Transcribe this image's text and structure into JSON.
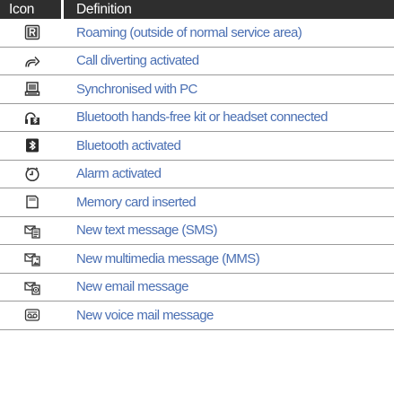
{
  "header": {
    "icon_col": "Icon",
    "definition_col": "Definition"
  },
  "colors": {
    "header_bg": "#2e2e2e",
    "header_text": "#ffffff",
    "definition_text": "#4a6fb3",
    "row_divider": "#9a9a9a",
    "icon_stroke": "#333333"
  },
  "rows": [
    {
      "icon": "roaming-icon",
      "definition": "Roaming (outside of normal service area)"
    },
    {
      "icon": "call-divert-icon",
      "definition": "Call diverting activated"
    },
    {
      "icon": "pc-sync-icon",
      "definition": "Synchronised with PC"
    },
    {
      "icon": "bt-headset-icon",
      "definition": "Bluetooth hands-free kit or headset connected"
    },
    {
      "icon": "bluetooth-icon",
      "definition": "Bluetooth activated"
    },
    {
      "icon": "alarm-icon",
      "definition": "Alarm activated"
    },
    {
      "icon": "memory-card-icon",
      "definition": "Memory card inserted"
    },
    {
      "icon": "sms-icon",
      "definition": "New text message (SMS)"
    },
    {
      "icon": "mms-icon",
      "definition": "New multimedia message (MMS)"
    },
    {
      "icon": "email-icon",
      "definition": "New email message"
    },
    {
      "icon": "voicemail-icon",
      "definition": "New voice mail message"
    }
  ]
}
